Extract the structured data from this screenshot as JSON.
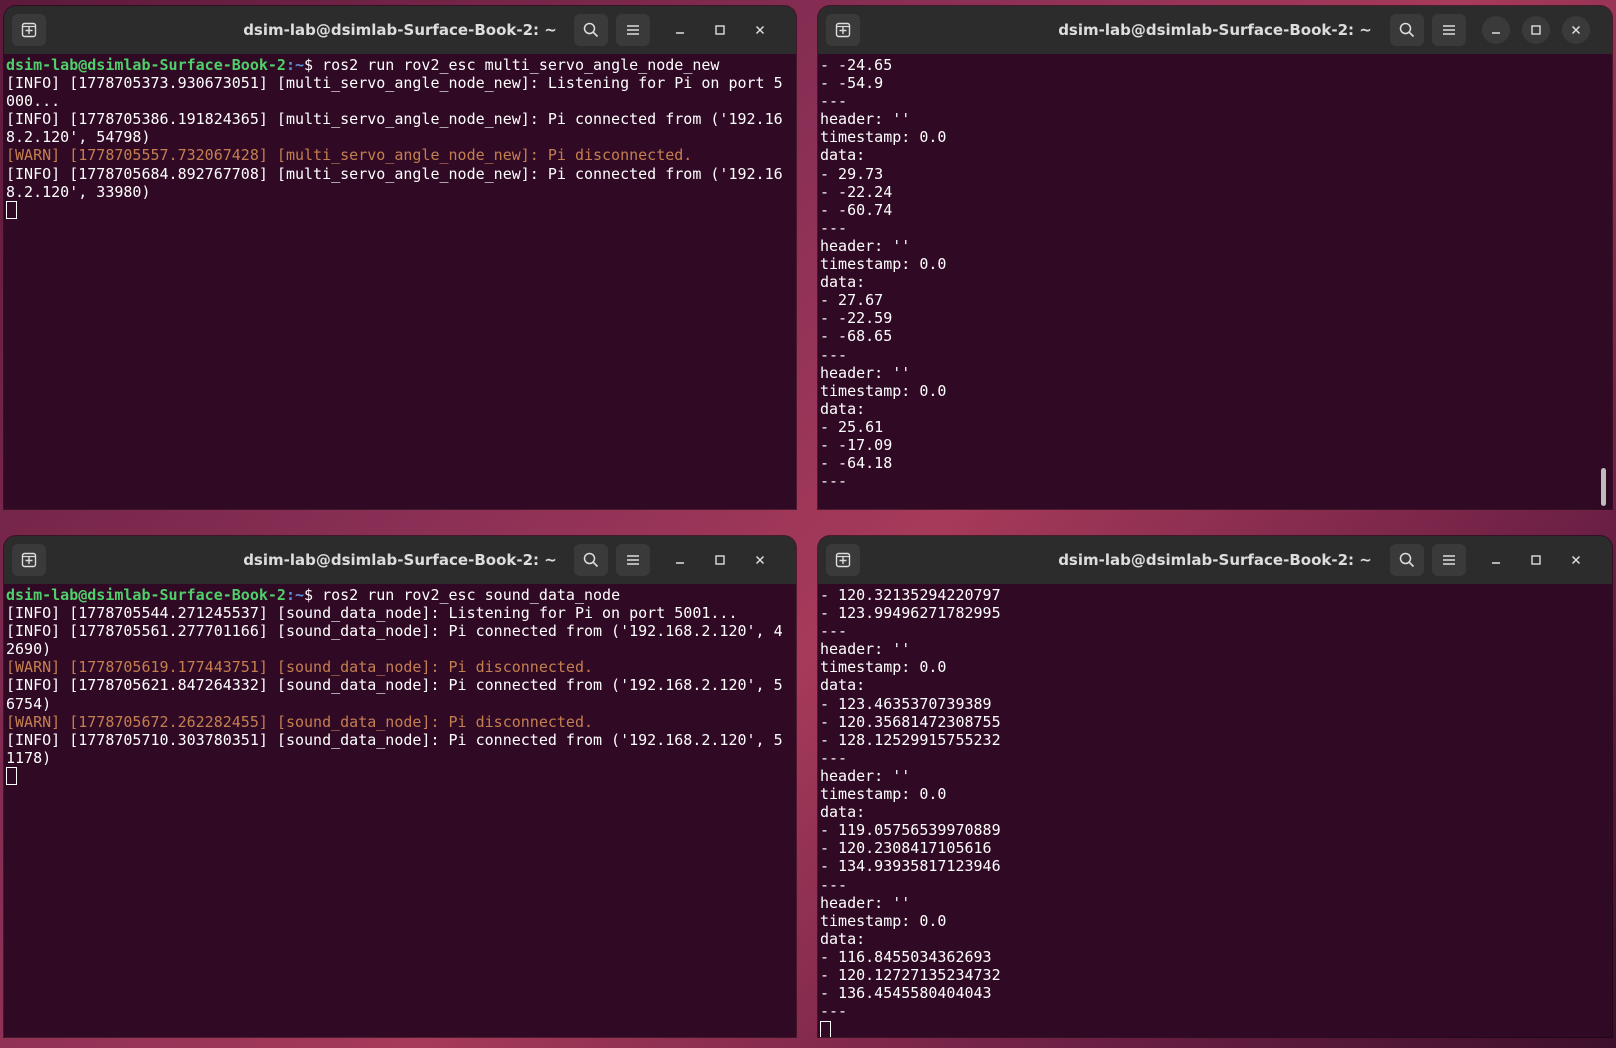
{
  "terminals": {
    "t1": {
      "title": "dsim-lab@dsimlab-Surface-Book-2: ~",
      "prompt_user": "dsim-lab@dsimlab-Surface-Book-2",
      "prompt_path": ":~",
      "prompt_symbol": "$ ",
      "command": "ros2 run rov2_esc multi_servo_angle_node_new",
      "lines": [
        {
          "type": "info",
          "text": "[INFO] [1778705373.930673051] [multi_servo_angle_node_new]: Listening for Pi on port 5"
        },
        {
          "type": "info",
          "text": "000..."
        },
        {
          "type": "info",
          "text": "[INFO] [1778705386.191824365] [multi_servo_angle_node_new]: Pi connected from ('192.16"
        },
        {
          "type": "info",
          "text": "8.2.120', 54798)"
        },
        {
          "type": "warn",
          "text": "[WARN] [1778705557.732067428] [multi_servo_angle_node_new]: Pi disconnected."
        },
        {
          "type": "info",
          "text": "[INFO] [1778705684.892767708] [multi_servo_angle_node_new]: Pi connected from ('192.16"
        },
        {
          "type": "info",
          "text": "8.2.120', 33980)"
        }
      ]
    },
    "t2": {
      "title": "dsim-lab@dsimlab-Surface-Book-2: ~",
      "lines": [
        "- -24.65",
        "- -54.9",
        "---",
        "header: ''",
        "timestamp: 0.0",
        "data:",
        "- 29.73",
        "- -22.24",
        "- -60.74",
        "---",
        "header: ''",
        "timestamp: 0.0",
        "data:",
        "- 27.67",
        "- -22.59",
        "- -68.65",
        "---",
        "header: ''",
        "timestamp: 0.0",
        "data:",
        "- 25.61",
        "- -17.09",
        "- -64.18",
        "---"
      ]
    },
    "t3": {
      "title": "dsim-lab@dsimlab-Surface-Book-2: ~",
      "prompt_user": "dsim-lab@dsimlab-Surface-Book-2",
      "prompt_path": ":~",
      "prompt_symbol": "$ ",
      "command": "ros2 run rov2_esc sound_data_node",
      "lines": [
        {
          "type": "info",
          "text": "[INFO] [1778705544.271245537] [sound_data_node]: Listening for Pi on port 5001..."
        },
        {
          "type": "info",
          "text": "[INFO] [1778705561.277701166] [sound_data_node]: Pi connected from ('192.168.2.120', 4"
        },
        {
          "type": "info",
          "text": "2690)"
        },
        {
          "type": "warn",
          "text": "[WARN] [1778705619.177443751] [sound_data_node]: Pi disconnected."
        },
        {
          "type": "info",
          "text": "[INFO] [1778705621.847264332] [sound_data_node]: Pi connected from ('192.168.2.120', 5"
        },
        {
          "type": "info",
          "text": "6754)"
        },
        {
          "type": "warn",
          "text": "[WARN] [1778705672.262282455] [sound_data_node]: Pi disconnected."
        },
        {
          "type": "info",
          "text": "[INFO] [1778705710.303780351] [sound_data_node]: Pi connected from ('192.168.2.120', 5"
        },
        {
          "type": "info",
          "text": "1178)"
        }
      ]
    },
    "t4": {
      "title": "dsim-lab@dsimlab-Surface-Book-2: ~",
      "lines": [
        "- 120.32135294220797",
        "- 123.99496271782995",
        "---",
        "header: ''",
        "timestamp: 0.0",
        "data:",
        "- 123.4635370739389",
        "- 120.35681472308755",
        "- 128.12529915755232",
        "---",
        "header: ''",
        "timestamp: 0.0",
        "data:",
        "- 119.05756539970889",
        "- 120.2308417105616",
        "- 134.93935817123946",
        "---",
        "header: ''",
        "timestamp: 0.0",
        "data:",
        "- 116.8455034362693",
        "- 120.12727135234732",
        "- 136.4545580404043",
        "---"
      ]
    }
  },
  "icons": {
    "new_tab": "new-tab-icon",
    "search": "search-icon",
    "menu": "hamburger-menu-icon",
    "minimize": "minimize-icon",
    "maximize": "maximize-icon",
    "close": "close-icon"
  },
  "colors": {
    "terminal_bg": "#300a24",
    "titlebar_bg": "#2c2c2c",
    "prompt_user": "#4fd06a",
    "prompt_path": "#5c8fd6",
    "warn": "#c47f50"
  }
}
